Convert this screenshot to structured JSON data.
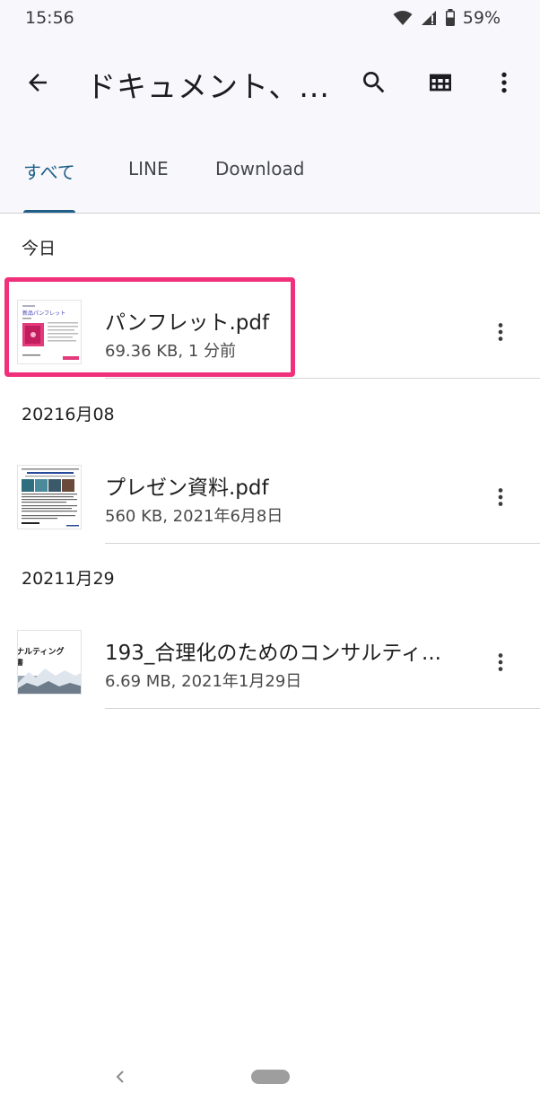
{
  "status_bar": {
    "time": "15:56",
    "battery": "59%",
    "icons": [
      "wifi-icon",
      "cell-signal-icon",
      "battery-icon"
    ]
  },
  "app_bar": {
    "title": "ドキュメント、...",
    "icons": [
      "back-arrow-icon",
      "search-icon",
      "grid-view-icon",
      "more-vert-icon"
    ]
  },
  "tabs": [
    {
      "label": "すべて",
      "selected": true
    },
    {
      "label": "LINE",
      "selected": false
    },
    {
      "label": "Download",
      "selected": false
    }
  ],
  "sections": [
    {
      "header": "今日",
      "files": [
        {
          "name": "パンフレット.pdf",
          "meta": "69.36 KB, 1 分前",
          "highlighted": true
        }
      ]
    },
    {
      "header": "20216月08",
      "files": [
        {
          "name": "プレゼン資料.pdf",
          "meta": "560 KB, 2021年6月8日"
        }
      ]
    },
    {
      "header": "20211月29",
      "files": [
        {
          "name": "193_合理化のためのコンサルティ...",
          "meta": "6.69 MB, 2021年1月29日"
        }
      ]
    }
  ],
  "thumbnails": {
    "pamphlet_text": "新品パンフレット",
    "consulting_text": "ナルティング",
    "consulting_text2": "書"
  },
  "colors": {
    "accent": "#1f5f87",
    "highlight": "#f0307a",
    "app_bar_bg": "#f8f7fc"
  }
}
